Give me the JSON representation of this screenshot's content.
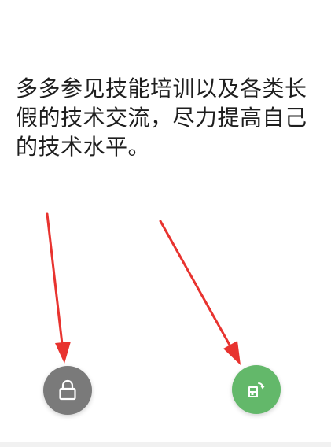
{
  "content": {
    "paragraph": "多多参见技能培训以及各类长\n假的技术交流，尽力提高自己\n的技术水平。"
  },
  "buttons": {
    "lock": {
      "icon": "lock-icon",
      "color": "#7a7a7a"
    },
    "rotate": {
      "icon": "screen-rotate-icon",
      "color": "#63b86a"
    }
  },
  "annotations": {
    "arrow_color": "#e8332f"
  }
}
